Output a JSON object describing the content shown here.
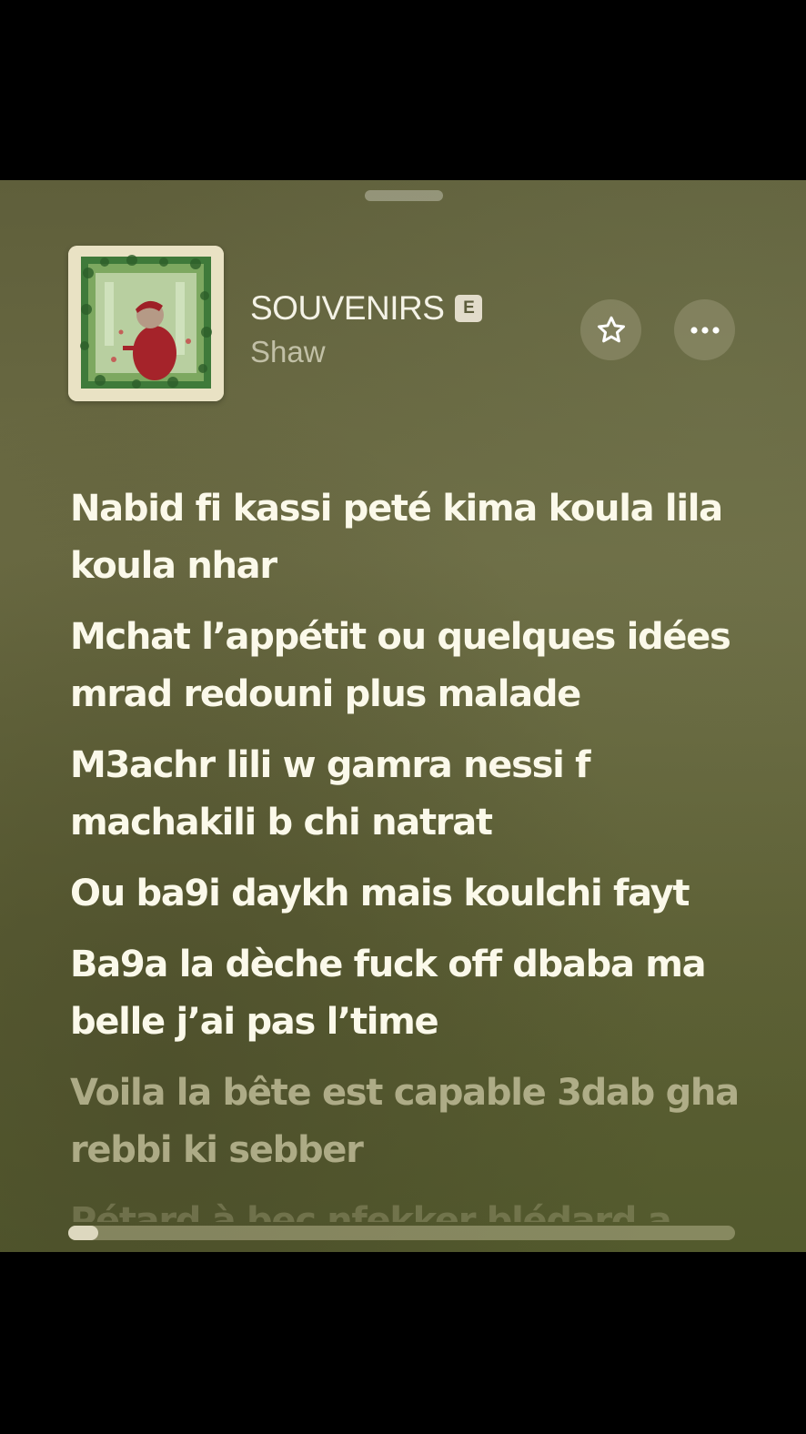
{
  "track": {
    "title": "SOUVENIRS",
    "explicit_badge": "E",
    "artist": "Shaw"
  },
  "buttons": {
    "favorite_icon": "star-icon",
    "more_icon": "ellipsis-icon"
  },
  "lyrics": {
    "lines": [
      {
        "text": "Nabid fi kassi peté kima koula lila koula nhar",
        "state": "past"
      },
      {
        "text": "Mchat l’appétit ou quelques idées mrad redouni plus malade",
        "state": "past"
      },
      {
        "text": "M3achr lili w gamra nessi f machakili b chi natrat",
        "state": "past"
      },
      {
        "text": "Ou ba9i daykh mais koulchi fayt",
        "state": "past"
      },
      {
        "text": "Ba9a la dèche fuck off dbaba ma belle  j’ai pas l’time",
        "state": "current"
      },
      {
        "text": "Voila la bête est capable 3dab gha rebbi ki sebber",
        "state": "upcoming"
      },
      {
        "text": "Pétard à bec nfekker blédard a",
        "state": "upcoming-faded"
      }
    ]
  },
  "progress": {
    "fraction": 0.045
  },
  "colors": {
    "background": "#66673f",
    "text_active": "#fbf9ea",
    "badge": "#e2dccb"
  }
}
